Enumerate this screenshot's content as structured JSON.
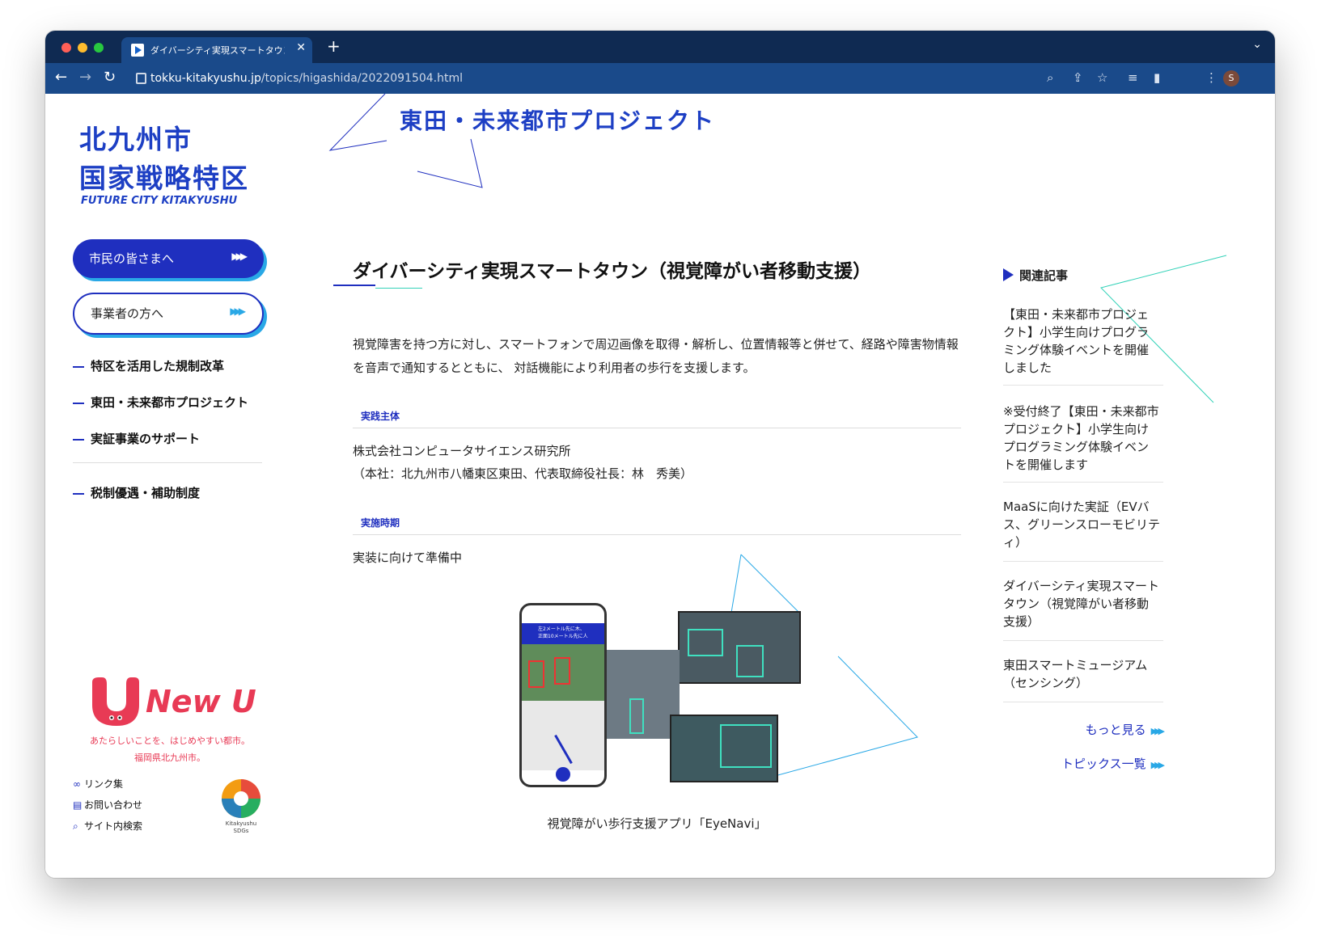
{
  "browser": {
    "tab_title": "ダイバーシティ実現スマートタウン",
    "url_host": "tokku-kitakyushu.jp",
    "url_path": "/topics/higashida/2022091504.html",
    "avatar_initial": "S"
  },
  "logo": {
    "line1": "北九州市",
    "line2": "国家戦略特区",
    "subtitle": "FUTURE CITY KITAKYUSHU"
  },
  "sidebar": {
    "btn_citizens": "市民の皆さまへ",
    "btn_business": "事業者の方へ",
    "menu": [
      "特区を活用した規制改革",
      "東田・未来都市プロジェクト",
      "実証事業のサポート",
      "税制優遇・補助制度"
    ],
    "newu_logo": "New U",
    "newu_tagline_1": "あたらしいことを、はじめやすい都市。",
    "newu_tagline_2": "福岡県北九州市。",
    "links": [
      "リンク集",
      "お問い合わせ",
      "サイト内検索"
    ],
    "sdgs_label_1": "Kitakyushu",
    "sdgs_label_2": "SDGs"
  },
  "main": {
    "section_title": "東田・未来都市プロジェクト",
    "article_title": "ダイバーシティ実現スマートタウン（視覚障がい者移動支援）",
    "intro": "視覚障害を持つ方に対し、スマートフォンで周辺画像を取得・解析し、位置情報等と併せて、経路や障害物情報を音声で通知するとともに、 対話機能により利用者の歩行を支援します。",
    "label_entity": "実践主体",
    "entity_name": "株式会社コンピュータサイエンス研究所",
    "entity_detail": "（本社：北九州市八幡東区東田、代表取締役社長：林　秀美）",
    "label_period": "実施時期",
    "period": "実装に向けて準備中",
    "app_banner_1": "左2メートル先に木、",
    "app_banner_2": "正面10メートル先に人",
    "caption": "視覚障がい歩行支援アプリ「EyeNavi」"
  },
  "related": {
    "heading": "関連記事",
    "items": [
      "【東田・未来都市プロジェクト】小学生向けプログラミング体験イベントを開催しました",
      "※受付終了【東田・未来都市プロジェクト】小学生向けプログラミング体験イベントを開催します",
      "MaaSに向けた実証（EVバス、グリーンスローモビリティ）",
      "ダイバーシティ実現スマートタウン（視覚障がい者移動支援）",
      "東田スマートミュージアム（センシング）"
    ],
    "more": "もっと見る",
    "topics": "トピックス一覧"
  },
  "colors": {
    "brand_blue": "#1f2fbf",
    "accent_cyan": "#29a8e6",
    "accent_green": "#33d2b8",
    "newu_red": "#e83a55",
    "chrome_dark": "#0f2a52",
    "chrome_toolbar": "#1a4a8a"
  }
}
